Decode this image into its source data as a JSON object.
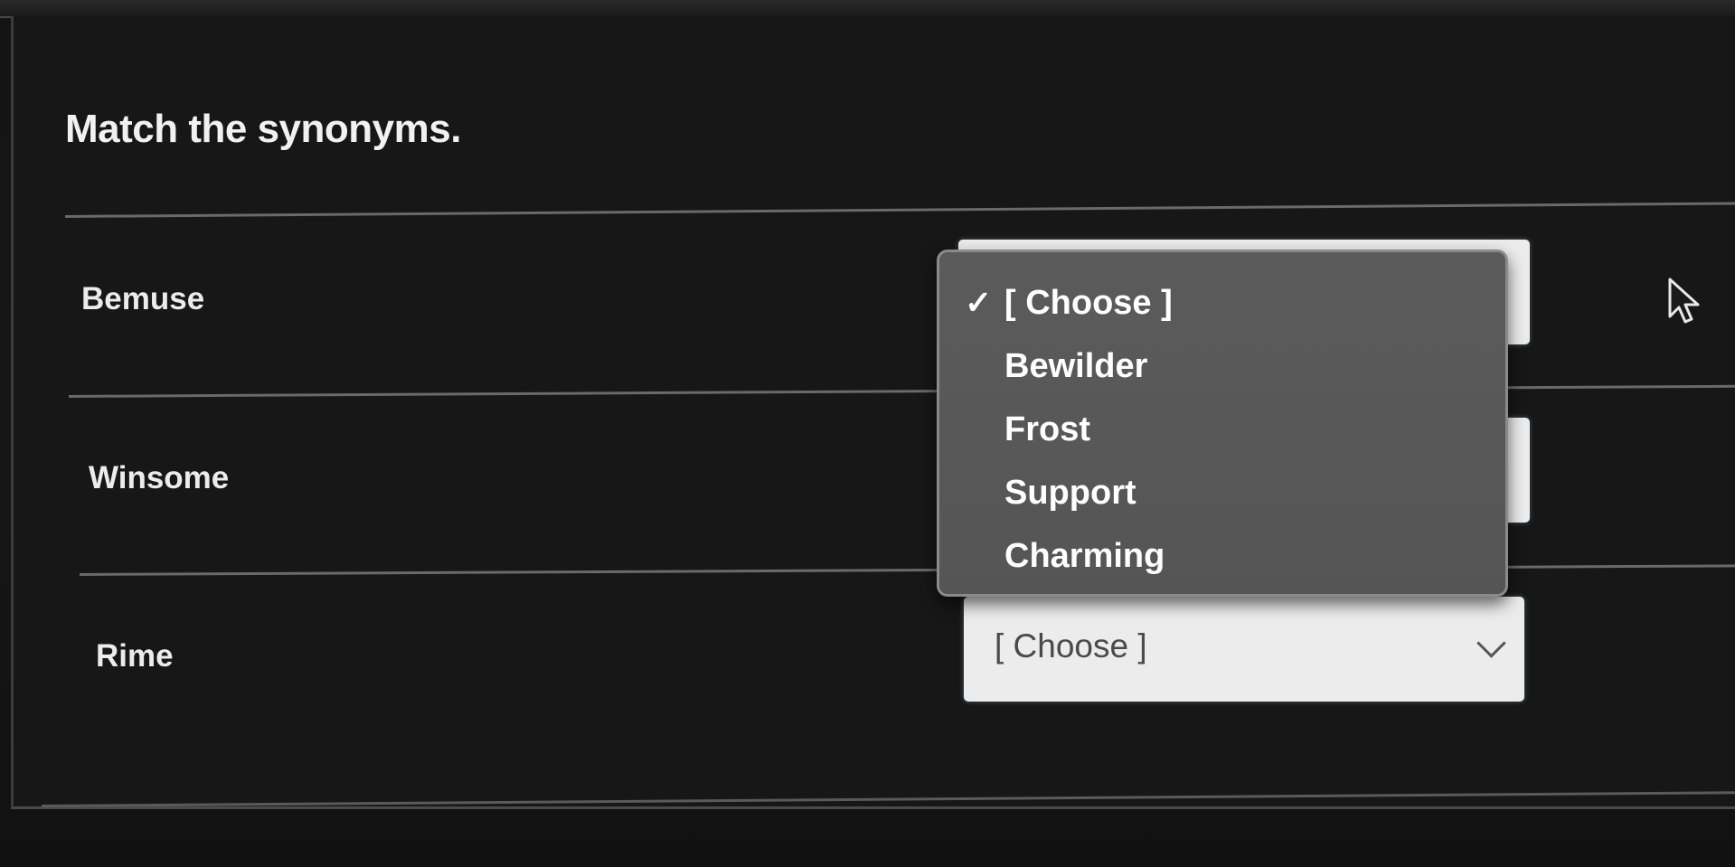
{
  "quiz": {
    "question": "Match the synonyms."
  },
  "rows": [
    {
      "prompt": "Bemuse",
      "selected": "[ Choose ]"
    },
    {
      "prompt": "Winsome",
      "selected": "[ Choose ]"
    },
    {
      "prompt": "Rime",
      "selected": "[ Choose ]"
    }
  ],
  "dropdown": {
    "open_for": "Bemuse",
    "options": [
      "[ Choose ]",
      "Bewilder",
      "Frost",
      "Support",
      "Charming"
    ],
    "checked": "[ Choose ]",
    "checkmark_glyph": "✓"
  },
  "colors": {
    "background": "#171717",
    "select_bg": "#ececec",
    "menu_bg": "#595959",
    "text": "#f1f1f1"
  },
  "icons": {
    "chevron": "chevron-down-icon",
    "check": "checkmark-icon",
    "cursor": "mouse-pointer-icon"
  }
}
